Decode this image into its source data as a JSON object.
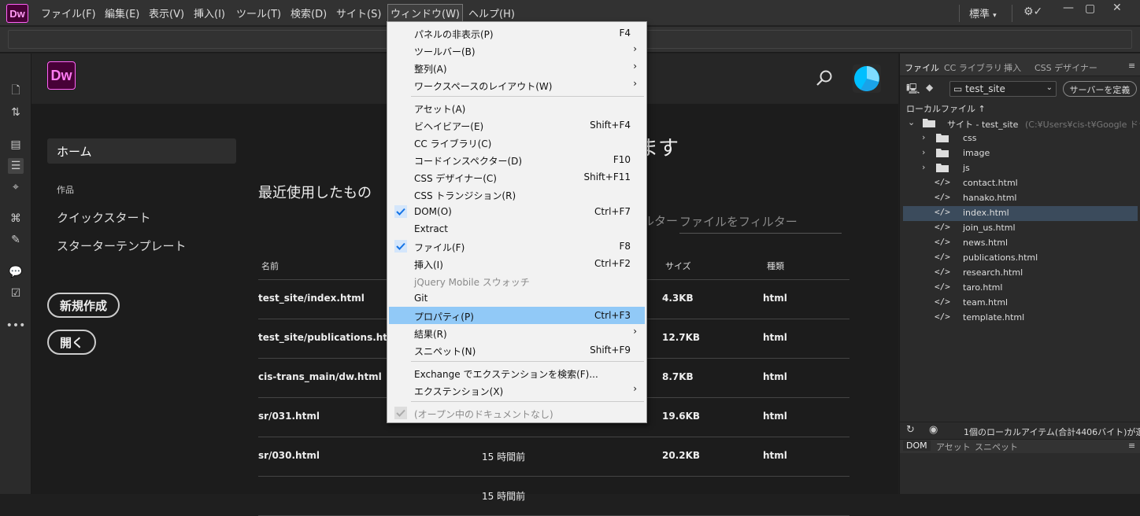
{
  "app": {
    "logo": "Dw",
    "brand_color": "#ff61f6"
  },
  "menubar": {
    "items": [
      "ファイル(F)",
      "編集(E)",
      "表示(V)",
      "挿入(I)",
      "ツール(T)",
      "検索(D)",
      "サイト(S)",
      "ウィンドウ(W)",
      "ヘルプ(H)"
    ],
    "active": "ウィンドウ(W)",
    "workspace": "標準",
    "icons": [
      "gear-check-icon",
      "minimize-icon",
      "restore-icon",
      "close-icon"
    ]
  },
  "window_menu": {
    "items": [
      {
        "label": "パネルの非表示(P)",
        "shortcut": "F4"
      },
      {
        "label": "ツールバー(B)",
        "submenu": true
      },
      {
        "label": "整列(A)",
        "submenu": true
      },
      {
        "label": "ワークスペースのレイアウト(W)",
        "submenu": true
      },
      {
        "label": "アセット(A)"
      },
      {
        "label": "ビヘイビアー(E)",
        "shortcut": "Shift+F4"
      },
      {
        "label": "CC ライブラリ(C)"
      },
      {
        "label": "コードインスペクター(D)",
        "shortcut": "F10"
      },
      {
        "label": "CSS デザイナー(C)",
        "shortcut": "Shift+F11"
      },
      {
        "label": "CSS トランジション(R)"
      },
      {
        "label": "DOM(O)",
        "shortcut": "Ctrl+F7",
        "checked": true
      },
      {
        "label": "Extract"
      },
      {
        "label": "ファイル(F)",
        "shortcut": "F8",
        "checked": true
      },
      {
        "label": "挿入(I)",
        "shortcut": "Ctrl+F2"
      },
      {
        "label": "jQuery Mobile スウォッチ",
        "disabled": true
      },
      {
        "label": "Git"
      },
      {
        "label": "プロパティ(P)",
        "shortcut": "Ctrl+F3",
        "highlighted": true
      },
      {
        "label": "結果(R)",
        "submenu": true
      },
      {
        "label": "スニペット(N)",
        "shortcut": "Shift+F9"
      },
      {
        "label": "Exchange でエクステンションを検索(F)..."
      },
      {
        "label": "エクステンション(X)",
        "submenu": true
      },
      {
        "label": "(オープン中のドキュメントなし)",
        "disabled": true,
        "checked": true
      }
    ],
    "highlight_color": "#91c9f7"
  },
  "home": {
    "logo": "Dw",
    "welcome_partial": "ます",
    "nav": {
      "home": "ホーム",
      "section_label": "作品",
      "links": [
        "クイックスタート",
        "スターターテンプレート"
      ],
      "new_button": "新規作成",
      "open_button": "開く"
    },
    "recent": {
      "title": "最近使用したもの",
      "filter_partial": "ルター",
      "filter_placeholder": "ファイルをフィルター",
      "columns": {
        "name": "名前",
        "size": "サイズ",
        "type": "種類"
      },
      "rows": [
        {
          "name": "test_site/index.html",
          "time": "",
          "size": "4.3KB",
          "type": "html"
        },
        {
          "name": "test_site/publications.html",
          "time": "",
          "size": "12.7KB",
          "type": "html"
        },
        {
          "name": "cis-trans_main/dw.html",
          "time": "",
          "size": "8.7KB",
          "type": "html"
        },
        {
          "name": "sr/031.html",
          "time": "",
          "size": "19.6KB",
          "type": "html"
        },
        {
          "name": "sr/030.html",
          "time": "15 時間前",
          "size": "20.2KB",
          "type": "html"
        },
        {
          "name": "",
          "time": "15 時間前",
          "size": "",
          "type": ""
        }
      ]
    }
  },
  "files_panel": {
    "tabs": [
      "ファイル",
      "CC ライブラリ",
      "挿入",
      "CSS デザイナー"
    ],
    "active_tab": "ファイル",
    "site": "test_site",
    "define_server": "サーバーを定義",
    "local_files": "ローカルファイル ↑",
    "root": "サイト - test_site",
    "root_path": "(C:¥Users¥cis-t¥Google ドライ",
    "tree": [
      {
        "name": "css",
        "kind": "folder"
      },
      {
        "name": "image",
        "kind": "folder"
      },
      {
        "name": "js",
        "kind": "folder"
      },
      {
        "name": "contact.html",
        "kind": "file"
      },
      {
        "name": "hanako.html",
        "kind": "file"
      },
      {
        "name": "index.html",
        "kind": "file",
        "selected": true
      },
      {
        "name": "join_us.html",
        "kind": "file"
      },
      {
        "name": "news.html",
        "kind": "file"
      },
      {
        "name": "publications.html",
        "kind": "file"
      },
      {
        "name": "research.html",
        "kind": "file"
      },
      {
        "name": "taro.html",
        "kind": "file"
      },
      {
        "name": "team.html",
        "kind": "file"
      },
      {
        "name": "template.html",
        "kind": "file"
      }
    ],
    "status": "1個のローカルアイテム(合計4406バイト)が選...",
    "bottom_tabs": [
      "DOM",
      "アセット",
      "スニペット"
    ],
    "bottom_active": "DOM"
  }
}
